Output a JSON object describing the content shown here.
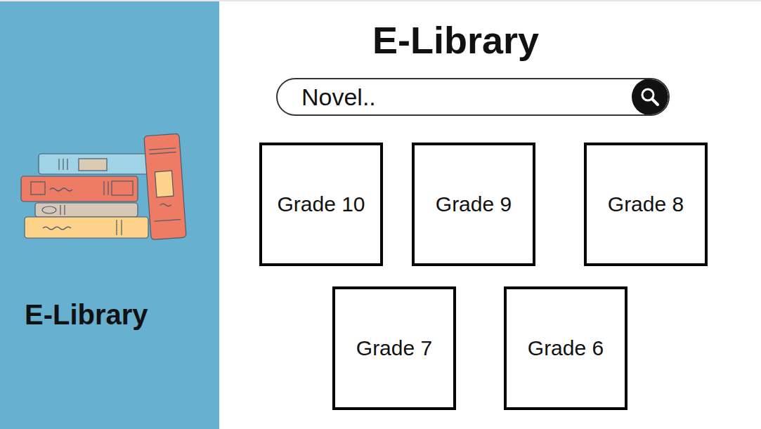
{
  "sidebar": {
    "title": "E-Library"
  },
  "header": {
    "title": "E-Library"
  },
  "search": {
    "placeholder": "Novel.."
  },
  "grades": [
    {
      "label": "Grade 10"
    },
    {
      "label": "Grade 9"
    },
    {
      "label": "Grade 8"
    },
    {
      "label": "Grade 7"
    },
    {
      "label": "Grade 6"
    }
  ]
}
